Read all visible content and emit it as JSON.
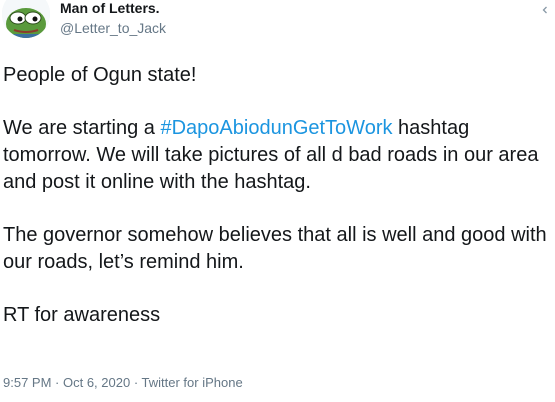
{
  "author": {
    "display_name": "Man of Letters.",
    "handle": "@Letter_to_Jack",
    "avatar_icon": "pepe-frog-avatar"
  },
  "header": {
    "more_icon": "chevron-icon"
  },
  "tweet": {
    "paragraph1": "People of Ogun state!",
    "paragraph2_before": "We are starting a ",
    "paragraph2_hashtag": "#DapoAbiodunGetToWork",
    "paragraph2_after": " hashtag tomorrow. We will take pictures of all d bad roads in our area and post it online with the hashtag.",
    "paragraph3": "The governor somehow believes that all is well and good with our roads, let’s remind him.",
    "paragraph4": "RT for awareness"
  },
  "meta": {
    "time": "9:57 PM",
    "separator1": " · ",
    "date": "Oct 6, 2020",
    "separator2": " · ",
    "source": "Twitter for iPhone"
  },
  "colors": {
    "hashtag": "#1b95e0",
    "secondary_text": "#657786",
    "primary_text": "#14171a"
  }
}
